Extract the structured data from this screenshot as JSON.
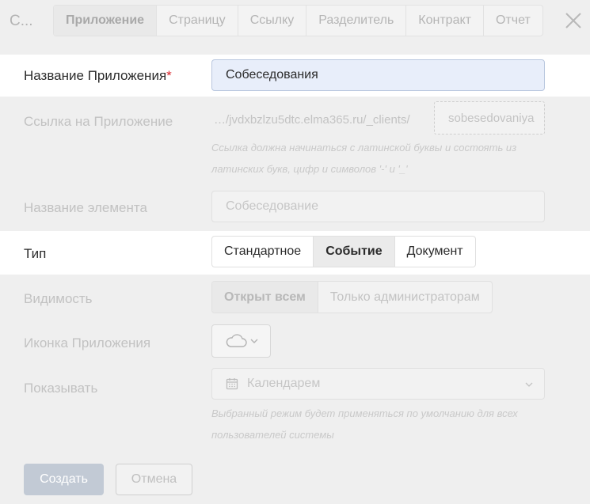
{
  "header": {
    "title": "С...",
    "tabs": [
      {
        "label": "Приложение",
        "active": true
      },
      {
        "label": "Страницу"
      },
      {
        "label": "Ссылку"
      },
      {
        "label": "Разделитель"
      },
      {
        "label": "Контракт"
      },
      {
        "label": "Отчет"
      }
    ]
  },
  "form": {
    "app_name": {
      "label": "Название Приложения",
      "required_mark": "*",
      "value": "Собеседования"
    },
    "app_link": {
      "label": "Ссылка на Приложение",
      "prefix": "…/jvdxbzlzu5dtc.elma365.ru/_clients/",
      "value": "sobesedovaniya",
      "hint_line1": "Ссылка должна начинаться с латинской буквы и состоять из",
      "hint_line2": "латинских букв, цифр и символов '-' и '_'"
    },
    "element_name": {
      "label": "Название элемента",
      "placeholder": "Собеседование"
    },
    "type": {
      "label": "Тип",
      "options": [
        "Стандартное",
        "Событие",
        "Документ"
      ],
      "selected": "Событие"
    },
    "visibility": {
      "label": "Видимость",
      "options": [
        "Открыт всем",
        "Только администраторам"
      ],
      "selected": "Открыт всем"
    },
    "icon": {
      "label": "Иконка Приложения",
      "icon": "cloud-icon"
    },
    "show_as": {
      "label": "Показывать",
      "value": "Календарем",
      "hint_line1": "Выбранный режим будет применяться по умолчанию для всех",
      "hint_line2": "пользователей системы"
    }
  },
  "buttons": {
    "create": "Создать",
    "cancel": "Отмена"
  },
  "colors": {
    "required": "#d9252b",
    "focus_field": "#e8eefa",
    "primary_disabled": "#c2cad5"
  }
}
